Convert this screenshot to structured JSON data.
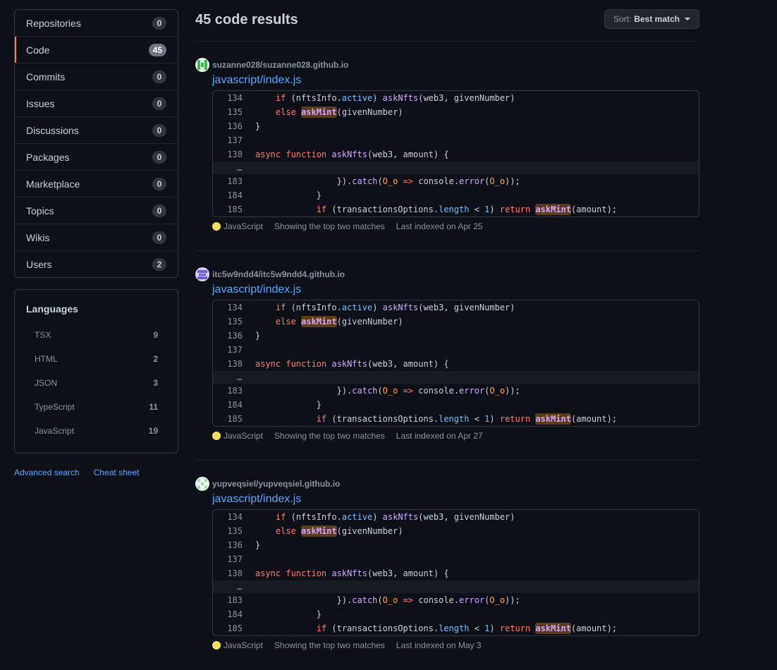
{
  "sidebar": {
    "items": [
      {
        "label": "Repositories",
        "count": "0"
      },
      {
        "label": "Code",
        "count": "45"
      },
      {
        "label": "Commits",
        "count": "0"
      },
      {
        "label": "Issues",
        "count": "0"
      },
      {
        "label": "Discussions",
        "count": "0"
      },
      {
        "label": "Packages",
        "count": "0"
      },
      {
        "label": "Marketplace",
        "count": "0"
      },
      {
        "label": "Topics",
        "count": "0"
      },
      {
        "label": "Wikis",
        "count": "0"
      },
      {
        "label": "Users",
        "count": "2"
      }
    ],
    "languages_title": "Languages",
    "languages": [
      {
        "name": "TSX",
        "count": "9"
      },
      {
        "name": "HTML",
        "count": "2"
      },
      {
        "name": "JSON",
        "count": "3"
      },
      {
        "name": "TypeScript",
        "count": "11"
      },
      {
        "name": "JavaScript",
        "count": "19"
      }
    ],
    "advanced_search": "Advanced search",
    "cheat_sheet": "Cheat sheet"
  },
  "main": {
    "title": "45 code results",
    "sort_prefix": "Sort:",
    "sort_value": "Best match",
    "results": [
      {
        "repo": "suzanne028/suzanne028.github.io",
        "file": "javascript/index.js",
        "language": "JavaScript",
        "matches": "Showing the top two matches",
        "indexed": "Last indexed on Apr 25"
      },
      {
        "repo": "itc5w9ndd4/itc5w9ndd4.github.io",
        "file": "javascript/index.js",
        "language": "JavaScript",
        "matches": "Showing the top two matches",
        "indexed": "Last indexed on Apr 27"
      },
      {
        "repo": "yupveqsiel/yupveqsiel.github.io",
        "file": "javascript/index.js",
        "language": "JavaScript",
        "matches": "Showing the top two matches",
        "indexed": "Last indexed on May 3"
      }
    ],
    "code_lines": [
      "134",
      "135",
      "136",
      "137",
      "138",
      "…",
      "183",
      "184",
      "185"
    ],
    "colors": {
      "language_dot": "#f1e05a",
      "selected_accent": "#f78166",
      "link": "#58a6ff",
      "match_highlight": "#5a3d1d"
    },
    "icons": {
      "lang": "language-dot-icon",
      "sort": "chevron-down-icon"
    }
  }
}
